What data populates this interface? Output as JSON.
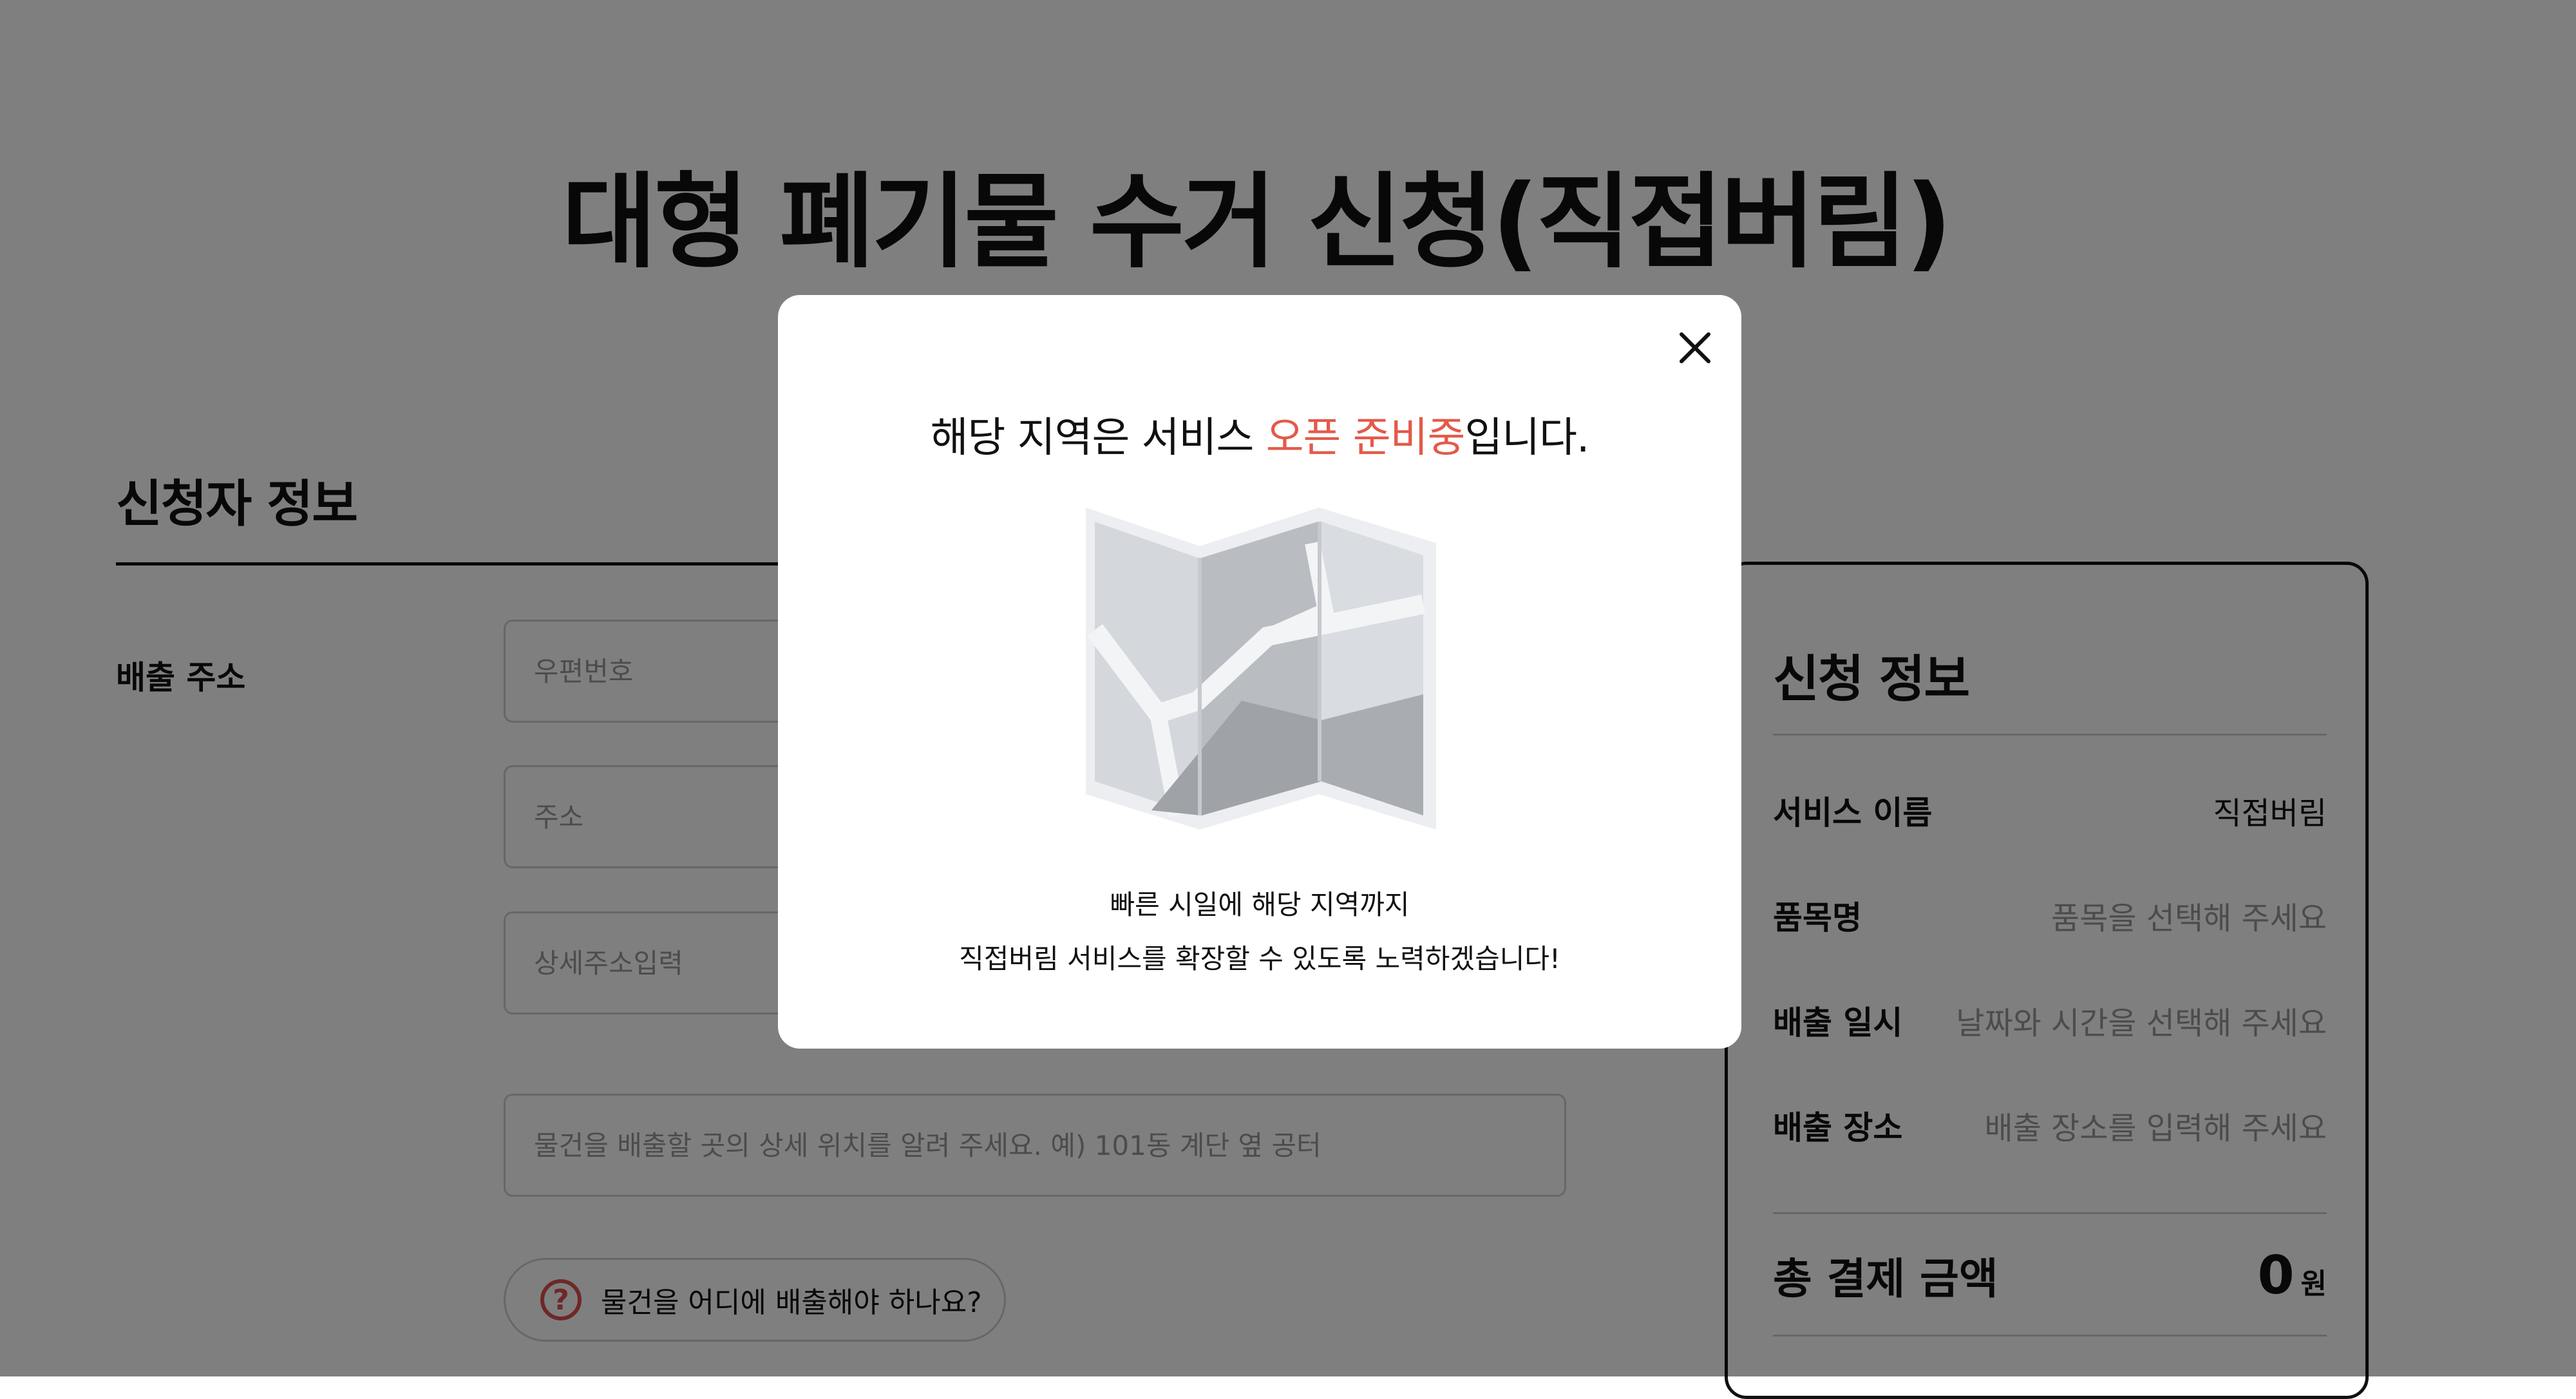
{
  "page": {
    "title": "대형 폐기물 수거 신청(직접버림)"
  },
  "applicant": {
    "section_title": "신청자 정보",
    "address_label": "배출 주소",
    "postal_placeholder": "우편번호",
    "address_placeholder": "주소",
    "detail_placeholder": "상세주소입력",
    "location_placeholder": "물건을 배출할 곳의 상세 위치를 알려 주세요. 예) 101동 계단 옆 공터",
    "hint_label": "물건을 어디에 배출해야 하나요?"
  },
  "summary": {
    "title": "신청 정보",
    "service_name_label": "서비스 이름",
    "service_name_value": "직접버림",
    "item_label": "품목명",
    "item_value": "품목을 선택해 주세요",
    "datetime_label": "배출 일시",
    "datetime_value": "날짜와 시간을 선택해 주세요",
    "place_label": "배출 장소",
    "place_value": "배출 장소를 입력해 주세요",
    "total_label": "총 결제 금액",
    "total_value": "0",
    "total_unit": "원"
  },
  "modal": {
    "headline_pre": "해당 지역은 서비스 ",
    "headline_highlight": "오픈 준비중",
    "headline_post": "입니다.",
    "body_line1": "빠른 시일에 해당 지역까지",
    "body_line2": "직접버림 서비스를 확장할 수 있도록 노력하겠습니다!",
    "highlight_color": "#e35a4a",
    "close_icon": "close-icon",
    "illustration": "folded-map-icon"
  }
}
